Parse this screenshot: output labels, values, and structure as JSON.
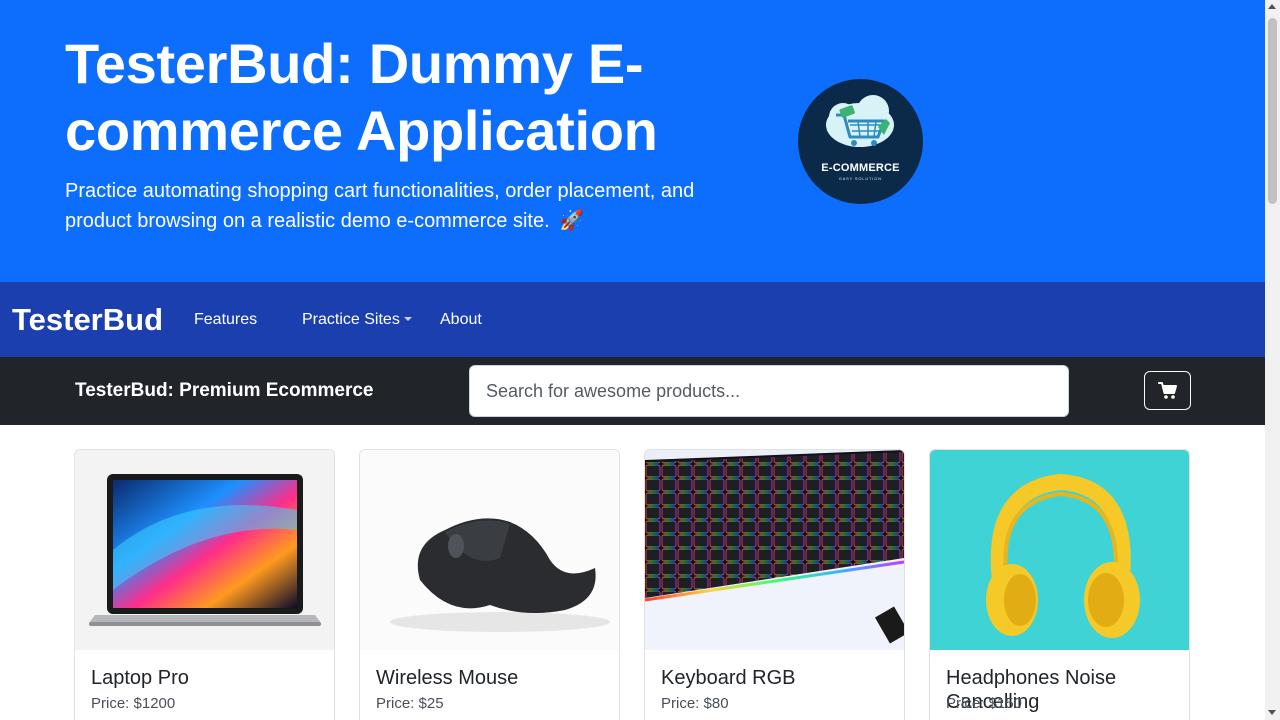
{
  "hero": {
    "title": "TesterBud: Dummy E-commerce Application",
    "subtitle": "Practice automating shopping cart functionalities, order placement, and product browsing on a realistic demo e-commerce site.",
    "rocket": "🚀",
    "logo_text": "E-COMMERCE",
    "logo_subtext": "EASY SOLUTION",
    "background_color": "#0d6efd"
  },
  "navbar": {
    "brand": "TesterBud",
    "links": [
      "Features",
      "Practice Sites",
      "About"
    ],
    "background_color": "#1b3fae"
  },
  "store_bar": {
    "title": "TesterBud: Premium Ecommerce",
    "search_placeholder": "Search for awesome products...",
    "cart_icon": "cart-icon",
    "background_color": "#212529"
  },
  "products": [
    {
      "name": "Laptop Pro",
      "price": "Price: $1200",
      "image": "laptop-image"
    },
    {
      "name": "Wireless Mouse",
      "price": "Price: $25",
      "image": "mouse-image"
    },
    {
      "name": "Keyboard RGB",
      "price": "Price: $80",
      "image": "keyboard-image"
    },
    {
      "name": "Headphones Noise Cancelling",
      "price": "Price: $150",
      "image": "headphones-image"
    }
  ]
}
